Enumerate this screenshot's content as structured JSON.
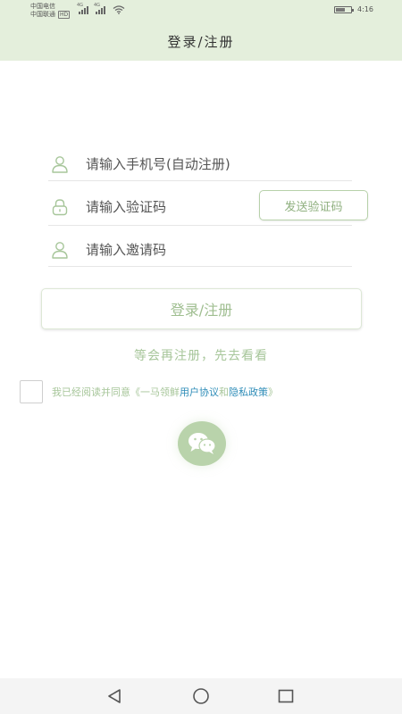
{
  "status_bar": {
    "carrier1": "中国电信",
    "carrier2": "中国联通",
    "hd": "HD",
    "sig1": "4G",
    "sig2": "4G",
    "time": "4:16"
  },
  "header": {
    "title": "登录/注册"
  },
  "form": {
    "phone": {
      "placeholder": "请输入手机号(自动注册)",
      "icon": "user-icon"
    },
    "code": {
      "placeholder": "请输入验证码",
      "icon": "lock-icon",
      "send_label": "发送验证码"
    },
    "invite": {
      "placeholder": "请输入邀请码",
      "icon": "user-icon"
    },
    "submit_label": "登录/注册",
    "later_label": "等会再注册，先去看看"
  },
  "agreement": {
    "prefix": "我已经阅读并同意《一马领鲜",
    "user_agreement": "用户协议",
    "and": "和",
    "privacy_policy": "隐私政策",
    "suffix": "》"
  },
  "social": {
    "wechat_icon": "wechat-icon"
  },
  "colors": {
    "header_bg": "#e4efdc",
    "accent": "#a7c69a",
    "link": "#2f8db8",
    "wechat_bg": "#b9d3ab"
  }
}
